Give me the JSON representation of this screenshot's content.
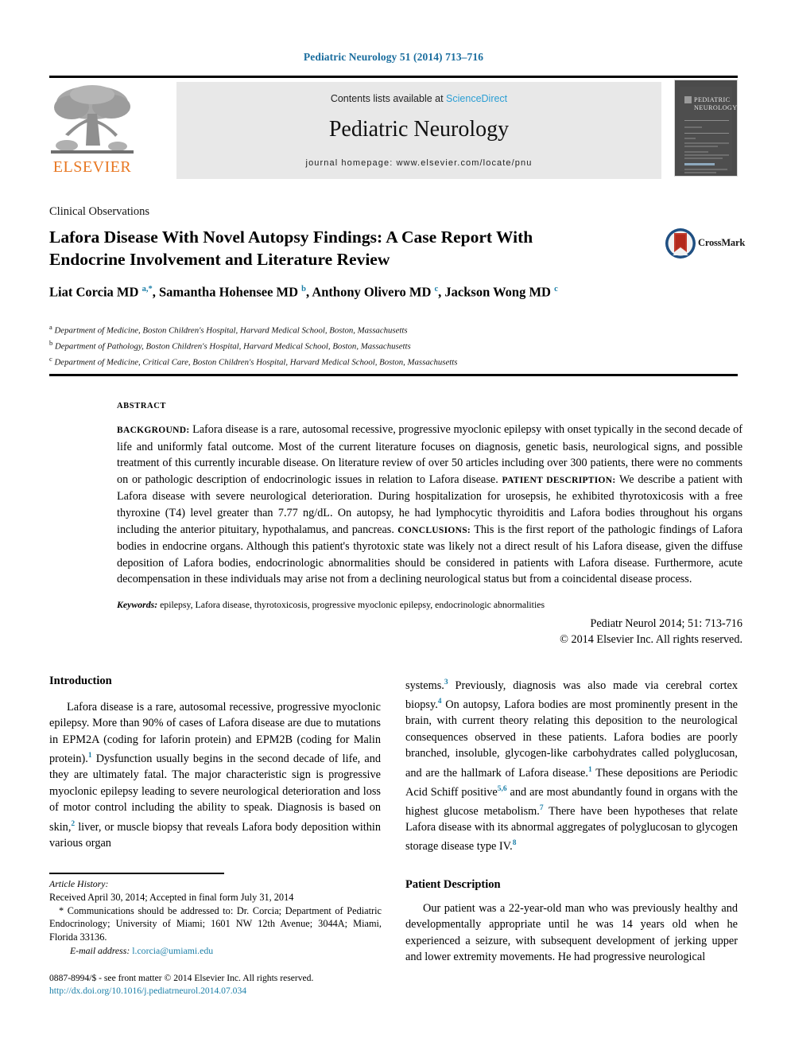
{
  "running_head": "Pediatric Neurology 51 (2014) 713–716",
  "masthead": {
    "publisher_logo_name": "elsevier-tree-logo",
    "publisher_word": "ELSEVIER",
    "contents_prefix": "Contents lists available at ",
    "contents_link": "ScienceDirect",
    "journal_name": "Pediatric Neurology",
    "homepage_label": "journal homepage: www.elsevier.com/locate/pnu",
    "cover_title_line1": "PEDIATRIC",
    "cover_title_line2": "NEUROLOGY",
    "link_color": "#2b9ed4",
    "band_color": "#e8e8e8"
  },
  "article": {
    "type": "Clinical Observations",
    "title": "Lafora Disease With Novel Autopsy Findings: A Case Report With Endocrine Involvement and Literature Review",
    "crossmark_label": "CrossMark",
    "authors_html": "Liat Corcia MD <sup>a,</sup><sup>*</sup>, Samantha Hohensee MD <sup>b</sup>, Anthony Olivero MD <sup>c</sup>, Jackson Wong MD <sup>c</sup>",
    "affiliations": [
      {
        "marker": "a",
        "text": "Department of Medicine, Boston Children's Hospital, Harvard Medical School, Boston, Massachusetts"
      },
      {
        "marker": "b",
        "text": "Department of Pathology, Boston Children's Hospital, Harvard Medical School, Boston, Massachusetts"
      },
      {
        "marker": "c",
        "text": "Department of Medicine, Critical Care, Boston Children's Hospital, Harvard Medical School, Boston, Massachusetts"
      }
    ]
  },
  "abstract": {
    "label": "ABSTRACT",
    "sections": [
      {
        "heading": "BACKGROUND:",
        "text": " Lafora disease is a rare, autosomal recessive, progressive myoclonic epilepsy with onset typically in the second decade of life and uniformly fatal outcome. Most of the current literature focuses on diagnosis, genetic basis, neurological signs, and possible treatment of this currently incurable disease. On literature review of over 50 articles including over 300 patients, there were no comments on or pathologic description of endocrinologic issues in relation to Lafora disease. "
      },
      {
        "heading": "PATIENT DESCRIPTION:",
        "text": " We describe a patient with Lafora disease with severe neurological deterioration. During hospitalization for urosepsis, he exhibited thyrotoxicosis with a free thyroxine (T4) level greater than 7.77 ng/dL. On autopsy, he had lymphocytic thyroiditis and Lafora bodies throughout his organs including the anterior pituitary, hypothalamus, and pancreas. "
      },
      {
        "heading": "CONCLUSIONS:",
        "text": " This is the first report of the pathologic findings of Lafora bodies in endocrine organs. Although this patient's thyrotoxic state was likely not a direct result of his Lafora disease, given the diffuse deposition of Lafora bodies, endocrinologic abnormalities should be considered in patients with Lafora disease. Furthermore, acute decompensation in these individuals may arise not from a declining neurological status but from a coincidental disease process."
      }
    ],
    "keywords_label": "Keywords:",
    "keywords_value": " epilepsy, Lafora disease, thyrotoxicosis, progressive myoclonic epilepsy, endocrinologic abnormalities",
    "citation": "Pediatr Neurol 2014; 51: 713-716",
    "copyright": "© 2014 Elsevier Inc. All rights reserved."
  },
  "body": {
    "left_heading": "Introduction",
    "left_paragraph_html": "Lafora disease is a rare, autosomal recessive, progressive myoclonic epilepsy. More than 90% of cases of Lafora disease are due to mutations in EPM2A (coding for laforin protein) and EPM2B (coding for Malin protein).<sup>1</sup> Dysfunction usually begins in the second decade of life, and they are ultimately fatal. The major characteristic sign is progressive myoclonic epilepsy leading to severe neurological deterioration and loss of motor control including the ability to speak. Diagnosis is based on skin,<sup>2</sup> liver, or muscle biopsy that reveals Lafora body deposition within various organ",
    "right_paragraph_html": "systems.<sup>3</sup> Previously, diagnosis was also made via cerebral cortex biopsy.<sup>4</sup> On autopsy, Lafora bodies are most prominently present in the brain, with current theory relating this deposition to the neurological consequences observed in these patients. Lafora bodies are poorly branched, insoluble, glycogen-like carbohydrates called polyglucosan, and are the hallmark of Lafora disease.<sup>1</sup> These depositions are Periodic Acid Schiff positive<sup>5,6</sup> and are most abundantly found in organs with the highest glucose metabolism.<sup>7</sup> There have been hypotheses that relate Lafora disease with its abnormal aggregates of polyglucosan to glycogen storage disease type IV.<sup>8</sup>",
    "patient_desc_heading": "Patient Description",
    "patient_desc_paragraph": "Our patient was a 22-year-old man who was previously healthy and developmentally appropriate until he was 14 years old when he experienced a seizure, with subsequent development of jerking upper and lower extremity movements. He had progressive neurological"
  },
  "footnotes": {
    "article_history_label": "Article History:",
    "article_history_dates": "Received April 30, 2014; Accepted in final form July 31, 2014",
    "correspondence": "* Communications should be addressed to: Dr. Corcia; Department of Pediatric Endocrinology; University of Miami; 1601 NW 12th Avenue; 3044A; Miami, Florida 33136.",
    "email_label": "E-mail address:",
    "email_address": " l.corcia@umiami.edu",
    "issn_line": "0887-8994/$ - see front matter © 2014 Elsevier Inc. All rights reserved.",
    "doi_line": "http://dx.doi.org/10.1016/j.pediatrneurol.2014.07.034",
    "link_color": "#1b7fa8"
  }
}
